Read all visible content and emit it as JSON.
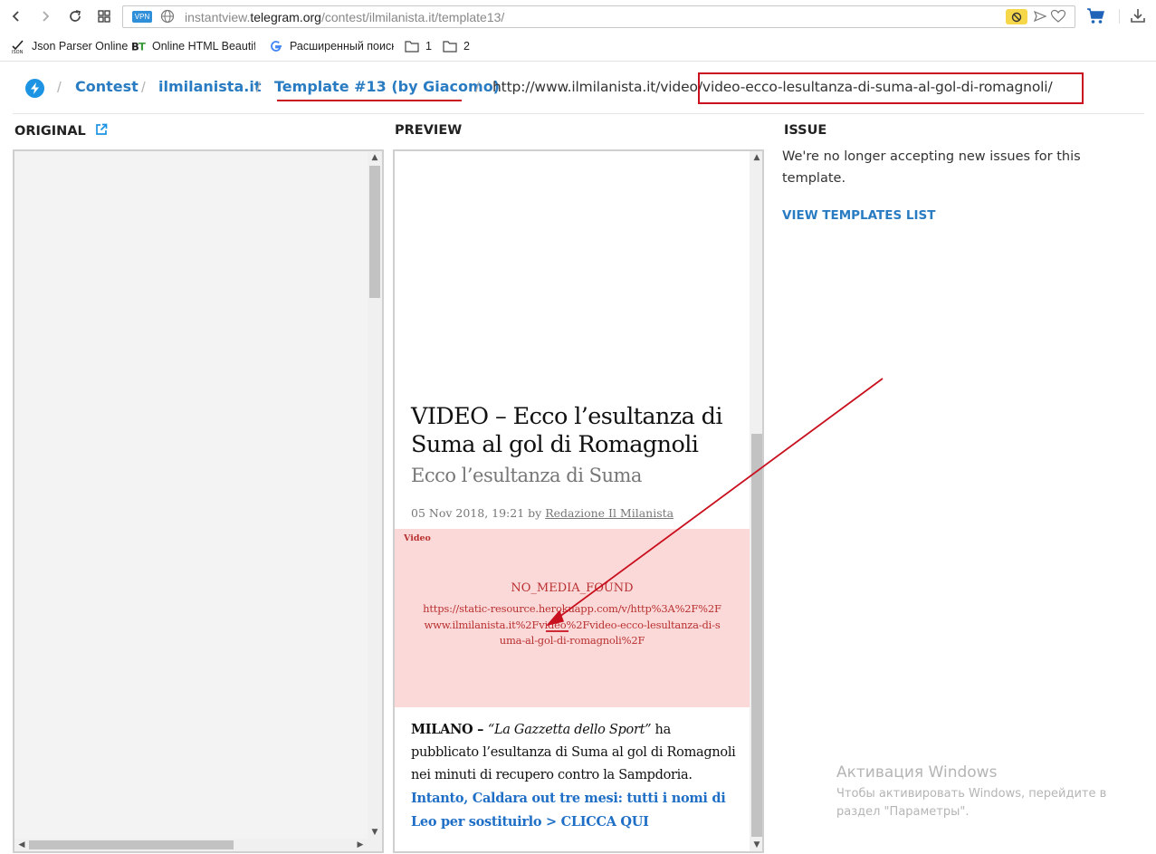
{
  "browser": {
    "url_prefix": "instantview.",
    "url_domain": "telegram.org",
    "url_path": "/contest/ilmilanista.it/template13/",
    "vpn_label": "VPN",
    "icons": [
      "back-icon",
      "forward-icon",
      "reload-icon",
      "speed-dial-icon",
      "globe-icon",
      "block-icon",
      "send-icon",
      "heart-icon",
      "cart-icon",
      "download-icon"
    ]
  },
  "bookmarks": [
    {
      "label": "Json Parser Online",
      "icon": "json-icon"
    },
    {
      "label": "Online HTML Beautifi",
      "icon": "bt-icon"
    },
    {
      "label": "Расширенный поиск",
      "icon": "google-icon"
    },
    {
      "label": "1",
      "icon": "folder-icon"
    },
    {
      "label": "2",
      "icon": "folder-icon"
    }
  ],
  "breadcrumb": {
    "items": [
      "Contest",
      "ilmilanista.it",
      "Template #13 (by Giacomo)"
    ],
    "url_plain": "http://www.ilmilanista.it/video",
    "url_highlight": "/video-ecco-lesultanza-di-suma-al-gol-di-romagnoli/"
  },
  "columns": {
    "original": "ORIGINAL",
    "preview": "PREVIEW",
    "issue": "ISSUE"
  },
  "article": {
    "title": "VIDEO – Ecco l’esultanza di Suma al gol di Romagnoli",
    "subtitle": "Ecco l’esultanza di Suma",
    "date": "05 Nov 2018, 19:21",
    "by": "by",
    "author": "Redazione Il Milanista",
    "media_tag": "Video",
    "media_error": "NO_MEDIA_FOUND",
    "media_url": "https://static-resource.herokuapp.com/v/http%3A%2F%2Fwww.ilmilanista.it%2Fvideo%2Fvideo-ecco-lesultanza-di-suma-al-gol-di-romagnoli%2F",
    "body_lead": "MILANO",
    "body_dash": " – ",
    "body_source": "“La Gazzetta dello Sport”",
    "body_text": " ha pubblicato l’esultanza di Suma al gol di Romagnoli nei minuti di recupero contro la Sampdoria.  ",
    "body_link": "Intanto, Caldara out tre mesi: tutti i nomi di Leo per sostituirlo > CLICCA QUI"
  },
  "issue": {
    "message": "We're no longer accepting new issues for this template.",
    "link": "VIEW TEMPLATES LIST"
  },
  "watermark": {
    "title": "Активация Windows",
    "text": "Чтобы активировать Windows, перейдите в раздел \"Параметры\"."
  },
  "colors": {
    "accent": "#2a7cc2",
    "annotation": "#c8101e",
    "error_bg": "#fcd9d9",
    "error_text": "#b83030"
  }
}
